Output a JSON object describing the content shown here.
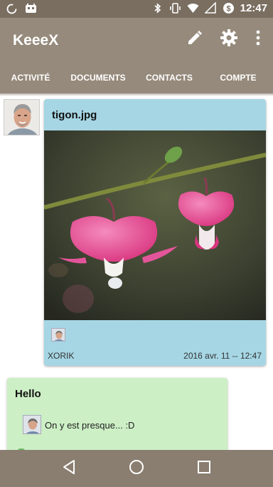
{
  "status_bar": {
    "time": "12:47",
    "icons": [
      "sync-icon",
      "android-debug-icon",
      "bluetooth-icon",
      "vibrate-icon",
      "wifi-icon",
      "signal-icon",
      "data-saver-icon"
    ]
  },
  "app_bar": {
    "title": "KeeeX",
    "actions": [
      "edit-icon",
      "settings-icon",
      "more-vert-icon"
    ]
  },
  "tabs": [
    {
      "label": "ACTIVITÉ",
      "active": true
    },
    {
      "label": "DOCUMENTS",
      "active": false
    },
    {
      "label": "CONTACTS",
      "active": false
    },
    {
      "label": "COMPTE",
      "active": false
    }
  ],
  "feed": {
    "items": [
      {
        "title": "tigon.jpg",
        "author": "XORIK",
        "date": "2016 avr. 11 -- 12:47",
        "card_color": "#a6d6e4"
      },
      {
        "title": "Hello",
        "message": "On y est presque... :D",
        "card_color": "#ccefc5"
      }
    ]
  },
  "nav_bar": {
    "buttons": [
      "back-icon",
      "home-icon",
      "recents-icon"
    ]
  },
  "colors": {
    "app_bar": "#968a7c",
    "status_bar": "#7a6e61",
    "nav_bar": "#8a7e70"
  }
}
